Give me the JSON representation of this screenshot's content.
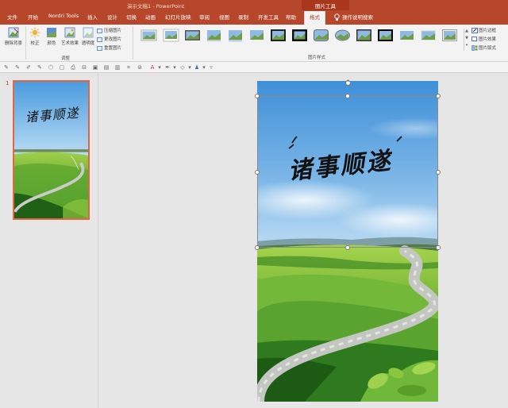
{
  "titlebar": {
    "doc_title": "演示文稿1  -  PowerPoint",
    "context_tab": "图片工具"
  },
  "tabs": [
    {
      "label": "文件"
    },
    {
      "label": "开始"
    },
    {
      "label": "Nordri Tools"
    },
    {
      "label": "插入"
    },
    {
      "label": "设计"
    },
    {
      "label": "切换"
    },
    {
      "label": "动画"
    },
    {
      "label": "幻灯片放映"
    },
    {
      "label": "审阅"
    },
    {
      "label": "视图"
    },
    {
      "label": "录制"
    },
    {
      "label": "开发工具"
    },
    {
      "label": "帮助"
    },
    {
      "label": "格式"
    }
  ],
  "tell_me": {
    "label": "操作说明搜索",
    "icon": "lightbulb-icon"
  },
  "ribbon": {
    "remove_bg": "删除背景",
    "corrections": "校正",
    "color": "颜色",
    "artistic": "艺术效果",
    "transparency": "透明度",
    "compress": "压缩图片",
    "change": "更改图片",
    "reset": "重置图片",
    "adjust_group": "调整",
    "styles_group": "图片样式",
    "border": "图片边框",
    "effects": "图片效果",
    "layout": "图片版式"
  },
  "slides": [
    {
      "number": "1",
      "calligraphy": "诸事顺遂"
    }
  ],
  "colors": {
    "accent": "#b7472a",
    "selected_thumb_border": "#e0673f"
  }
}
